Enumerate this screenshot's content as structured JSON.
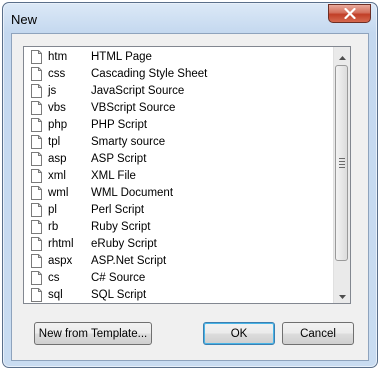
{
  "window": {
    "title": "New"
  },
  "file_types": [
    {
      "ext": "htm",
      "desc": "HTML Page"
    },
    {
      "ext": "css",
      "desc": "Cascading Style Sheet"
    },
    {
      "ext": "js",
      "desc": "JavaScript Source"
    },
    {
      "ext": "vbs",
      "desc": "VBScript Source"
    },
    {
      "ext": "php",
      "desc": "PHP Script"
    },
    {
      "ext": "tpl",
      "desc": "Smarty source"
    },
    {
      "ext": "asp",
      "desc": "ASP Script"
    },
    {
      "ext": "xml",
      "desc": "XML File"
    },
    {
      "ext": "wml",
      "desc": "WML Document"
    },
    {
      "ext": "pl",
      "desc": "Perl Script"
    },
    {
      "ext": "rb",
      "desc": "Ruby Script"
    },
    {
      "ext": "rhtml",
      "desc": "eRuby Script"
    },
    {
      "ext": "aspx",
      "desc": "ASP.Net Script"
    },
    {
      "ext": "cs",
      "desc": "C# Source"
    },
    {
      "ext": "sql",
      "desc": "SQL Script"
    }
  ],
  "buttons": {
    "template_label": "New from Template...",
    "ok_label": "OK",
    "cancel_label": "Cancel"
  },
  "icons": {
    "close": "close-icon",
    "file": "file-icon",
    "scroll_up": "arrow-up-icon",
    "scroll_down": "arrow-down-icon"
  }
}
